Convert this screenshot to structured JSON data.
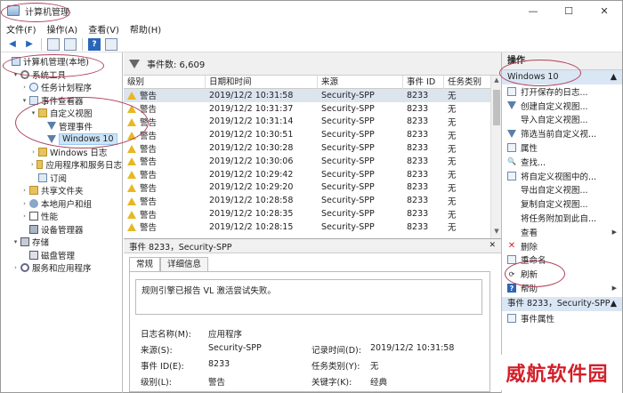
{
  "window": {
    "title": "计算机管理",
    "buttons": [
      "—",
      "☐",
      "✕"
    ]
  },
  "menubar": [
    "文件(F)",
    "操作(A)",
    "查看(V)",
    "帮助(H)"
  ],
  "tree": [
    {
      "label": "计算机管理(本地)",
      "icon": "computer-icon",
      "indent": 0,
      "exp": ""
    },
    {
      "label": "系统工具",
      "icon": "gear-icon",
      "indent": 1,
      "exp": "▾"
    },
    {
      "label": "任务计划程序",
      "icon": "clock-icon",
      "indent": 2,
      "exp": "›"
    },
    {
      "label": "事件查看器",
      "icon": "log-icon",
      "indent": 2,
      "exp": "▾"
    },
    {
      "label": "自定义视图",
      "icon": "folder-icon",
      "indent": 3,
      "exp": "▾"
    },
    {
      "label": "管理事件",
      "icon": "funnel-icon",
      "indent": 4,
      "exp": ""
    },
    {
      "label": "Windows 10",
      "icon": "funnel-icon",
      "indent": 4,
      "exp": "",
      "selected": true
    },
    {
      "label": "Windows 日志",
      "icon": "folder-icon",
      "indent": 3,
      "exp": "›"
    },
    {
      "label": "应用程序和服务日志",
      "icon": "folder-icon",
      "indent": 3,
      "exp": "›"
    },
    {
      "label": "订阅",
      "icon": "log-icon",
      "indent": 3,
      "exp": ""
    },
    {
      "label": "共享文件夹",
      "icon": "share-icon",
      "indent": 2,
      "exp": "›"
    },
    {
      "label": "本地用户和组",
      "icon": "users-icon",
      "indent": 2,
      "exp": "›"
    },
    {
      "label": "性能",
      "icon": "perf-icon",
      "indent": 2,
      "exp": "›"
    },
    {
      "label": "设备管理器",
      "icon": "device-icon",
      "indent": 2,
      "exp": ""
    },
    {
      "label": "存储",
      "icon": "storage-icon",
      "indent": 1,
      "exp": "▾"
    },
    {
      "label": "磁盘管理",
      "icon": "disk-icon",
      "indent": 2,
      "exp": ""
    },
    {
      "label": "服务和应用程序",
      "icon": "services-icon",
      "indent": 1,
      "exp": "›"
    }
  ],
  "center": {
    "header_label": "事件数: 6,609",
    "columns": [
      "级别",
      "日期和时间",
      "来源",
      "事件 ID",
      "任务类别"
    ],
    "rows": [
      [
        "警告",
        "2019/12/2 10:31:58",
        "Security-SPP",
        "8233",
        "无"
      ],
      [
        "警告",
        "2019/12/2 10:31:37",
        "Security-SPP",
        "8233",
        "无"
      ],
      [
        "警告",
        "2019/12/2 10:31:14",
        "Security-SPP",
        "8233",
        "无"
      ],
      [
        "警告",
        "2019/12/2 10:30:51",
        "Security-SPP",
        "8233",
        "无"
      ],
      [
        "警告",
        "2019/12/2 10:30:28",
        "Security-SPP",
        "8233",
        "无"
      ],
      [
        "警告",
        "2019/12/2 10:30:06",
        "Security-SPP",
        "8233",
        "无"
      ],
      [
        "警告",
        "2019/12/2 10:29:42",
        "Security-SPP",
        "8233",
        "无"
      ],
      [
        "警告",
        "2019/12/2 10:29:20",
        "Security-SPP",
        "8233",
        "无"
      ],
      [
        "警告",
        "2019/12/2 10:28:58",
        "Security-SPP",
        "8233",
        "无"
      ],
      [
        "警告",
        "2019/12/2 10:28:35",
        "Security-SPP",
        "8233",
        "无"
      ],
      [
        "警告",
        "2019/12/2 10:28:15",
        "Security-SPP",
        "8233",
        "无"
      ]
    ]
  },
  "detail": {
    "header": "事件 8233，Security-SPP",
    "tabs": [
      "常规",
      "详细信息"
    ],
    "message": "规则引擎已报告 VL 激活尝试失败。",
    "fields": {
      "log_name_label": "日志名称(M):",
      "log_name": "应用程序",
      "source_label": "来源(S):",
      "source": "Security-SPP",
      "logged_label": "记录时间(D):",
      "logged": "2019/12/2 10:31:58",
      "event_id_label": "事件 ID(E):",
      "event_id": "8233",
      "task_label": "任务类别(Y):",
      "task": "无",
      "level_label": "级别(L):",
      "level": "警告",
      "keywords_label": "关键字(K):",
      "keywords": "经典"
    }
  },
  "actions": {
    "header": "操作",
    "group1": "Windows 10",
    "items": [
      {
        "label": "打开保存的日志...",
        "icon": "open-log-icon"
      },
      {
        "label": "创建自定义视图...",
        "icon": "filter-icon"
      },
      {
        "label": "导入自定义视图...",
        "icon": "blank"
      },
      {
        "label": "筛选当前自定义视...",
        "icon": "filter-icon"
      },
      {
        "label": "属性",
        "icon": "properties-icon"
      },
      {
        "label": "查找...",
        "icon": "find-icon"
      },
      {
        "label": "将自定义视图中的...",
        "icon": "save-icon"
      },
      {
        "label": "导出自定义视图...",
        "icon": "blank"
      },
      {
        "label": "复制自定义视图...",
        "icon": "blank"
      },
      {
        "label": "将任务附加到此自...",
        "icon": "blank"
      },
      {
        "label": "查看",
        "icon": "blank",
        "submenu": true
      },
      {
        "label": "删除",
        "icon": "delete-icon"
      },
      {
        "label": "重命名",
        "icon": "rename-icon"
      },
      {
        "label": "刷新",
        "icon": "refresh-icon"
      },
      {
        "label": "帮助",
        "icon": "help-icon",
        "submenu": true
      }
    ],
    "group2": "事件 8233，Security-SPP",
    "group2_item": "事件属性"
  },
  "watermark": "威航软件园"
}
